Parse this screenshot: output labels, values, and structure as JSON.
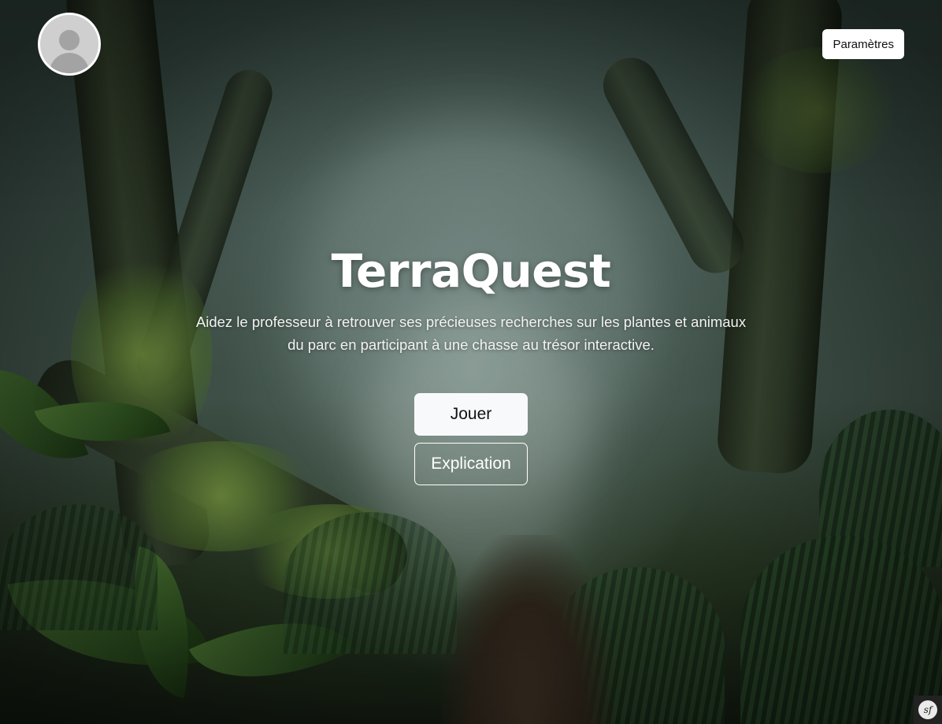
{
  "app": {
    "title": "TerraQuest",
    "description": "Aidez le professeur à retrouver ses précieuses recherches sur les plantes et animaux du parc en participant à une chasse au trésor interactive."
  },
  "header": {
    "avatar_icon": "user-avatar-icon",
    "settings_label": "Paramètres"
  },
  "actions": {
    "play_label": "Jouer",
    "explain_label": "Explication"
  },
  "debug_toolbar": {
    "icon": "symfony-logo-icon",
    "logo_text": "sf"
  },
  "colors": {
    "button_light": "#f8f9fb",
    "text_light": "#ffffff",
    "jungle_dark": "#1d2a22"
  }
}
